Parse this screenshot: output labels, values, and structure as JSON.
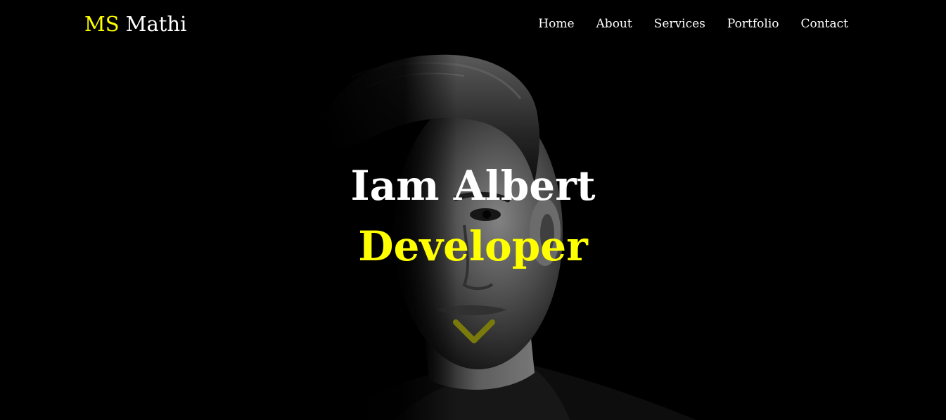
{
  "brand": {
    "part1": "MS",
    "part2": "Mathi"
  },
  "nav": {
    "items": [
      "Home",
      "About",
      "Services",
      "Portfolio",
      "Contact"
    ]
  },
  "hero": {
    "headline": "Iam Albert",
    "role": "Developer"
  },
  "colors": {
    "accent": "#ffff00",
    "background": "#000000",
    "text": "#ffffff",
    "chevron": "#7a7a0c"
  },
  "icons": {
    "scroll": "chevron-down-icon"
  }
}
